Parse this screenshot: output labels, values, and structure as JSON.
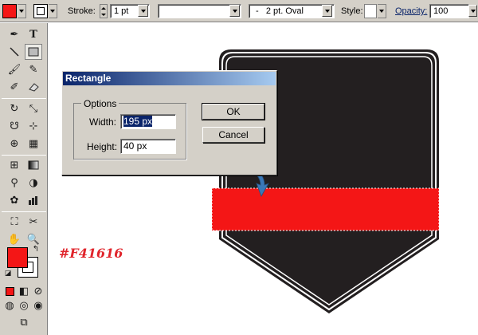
{
  "control_bar": {
    "fill_color": "#F41616",
    "stroke_label": "Stroke:",
    "stroke_weight": "1 pt",
    "brush_value": "",
    "brush_definition": "2 pt. Oval",
    "brush_definition_prefix": "-",
    "style_label": "Style:",
    "opacity_label": "Opacity:",
    "opacity_value": "100"
  },
  "tools": [
    "pen-tool-icon",
    "type-tool-icon",
    "line-tool-icon",
    "rectangle-tool-icon",
    "paintbrush-tool-icon",
    "pencil-tool-icon",
    "blob-brush-icon",
    "eraser-icon",
    "rotate-tool-icon",
    "scale-tool-icon",
    "warp-tool-icon",
    "free-transform-icon",
    "shape-builder-icon",
    "perspective-grid-icon",
    "mesh-tool-icon",
    "gradient-tool-icon",
    "eyedropper-icon",
    "blend-tool-icon",
    "symbol-sprayer-icon",
    "graph-tool-icon",
    "artboard-tool-icon",
    "slice-tool-icon",
    "hand-tool-icon",
    "zoom-tool-icon"
  ],
  "colors": {
    "fill": "#F41616",
    "badge": "#231f20",
    "stroke_box": "#ffffff"
  },
  "annotation": {
    "hex": "#F41616"
  },
  "dialog": {
    "title": "Rectangle",
    "options_label": "Options",
    "width_label": "Width:",
    "width_value": "195 px",
    "height_label": "Height:",
    "height_value": "40 px",
    "ok_label": "OK",
    "cancel_label": "Cancel"
  }
}
